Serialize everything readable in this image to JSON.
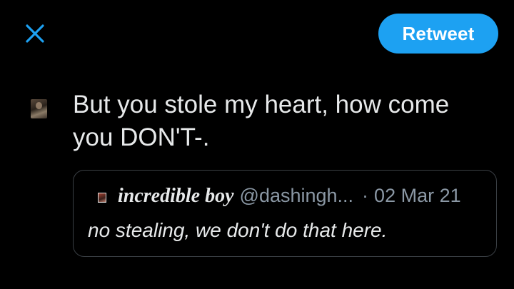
{
  "header": {
    "close_icon": "close-icon",
    "retweet_label": "Retweet"
  },
  "compose": {
    "text": "But you stole my heart, how come\nyou DON'T-."
  },
  "quote": {
    "display_name": "incredible boy",
    "handle": "@dashingh...",
    "separator": "·",
    "date": "02 Mar 21",
    "text": "no stealing, we don't do that here."
  },
  "colors": {
    "background": "#000000",
    "accent": "#1da1f2",
    "text": "#e7e9ea",
    "muted": "#8b98a5",
    "border": "#3a3f44"
  }
}
